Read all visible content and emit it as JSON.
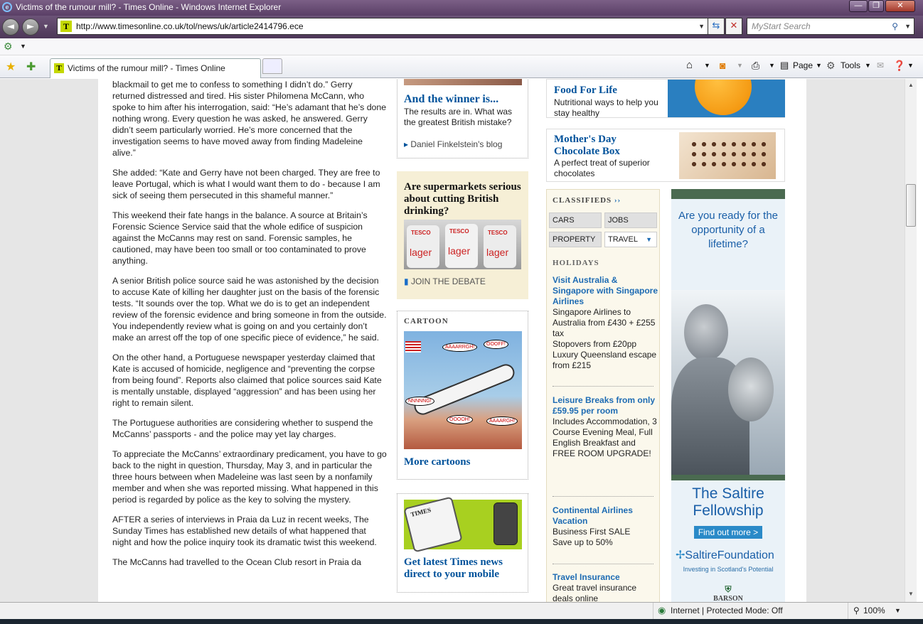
{
  "window": {
    "title": "Victims of the rumour mill? - Times Online - Windows Internet Explorer",
    "minimize": "—",
    "restore": "❐",
    "close": "✕"
  },
  "toolbar": {
    "url": "http://www.timesonline.co.uk/tol/news/uk/article2414796.ece",
    "search_placeholder": "MyStart Search",
    "favicon_letter": "T"
  },
  "tab": {
    "label": "Victims of the rumour mill? - Times Online"
  },
  "commandbar": {
    "page": "Page",
    "tools": "Tools"
  },
  "article": {
    "paragraphs": [
      "blackmail to get me to confess to something I didn’t do.” Gerry returned distressed and tired. His sister Philomena McCann, who spoke to him after his interrogation, said: “He’s adamant that he’s done nothing wrong. Every question he was asked, he answered. Gerry didn’t seem particularly worried. He’s more concerned that the investigation seems to have moved away from finding Madeleine alive.”",
      "She added: “Kate and Gerry have not been charged. They are free to leave Portugal, which is what I would want them to do - because I am sick of seeing them persecuted in this shameful manner.”",
      "This weekend their fate hangs in the balance. A source at Britain’s Forensic Science Service said that the whole edifice of suspicion against the McCanns may rest on sand. Forensic samples, he cautioned, may have been too small or too contaminated to prove anything.",
      "A senior British police source said he was astonished by the decision to accuse Kate of killing her daughter just on the basis of the forensic tests. “It sounds over the top. What we do is to get an independent review of the forensic evidence and bring someone in from the outside. You independently review what is going on and you certainly don’t make an arrest off the top of one specific piece of evidence,” he said.",
      "On the other hand, a Portuguese newspaper yesterday claimed that Kate is accused of homicide, negligence and “preventing the corpse from being found”. Reports also claimed that police sources said Kate is mentally unstable, displayed “aggression” and has been using her right to remain silent.",
      "The Portuguese authorities are considering whether to suspend the McCanns’ passports - and the police may yet lay charges.",
      "To appreciate the McCanns’ extraordinary predicament, you have to go back to the night in question, Thursday, May 3, and in particular the three hours between when Madeleine was last seen by a nonfamily member and when she was reported missing. What happened in this period is regarded by police as the key to solving the mystery.",
      "AFTER a series of interviews in Praia da Luz in recent weeks, The Sunday Times has established new details of what happened that night and how the police inquiry took its dramatic twist this weekend.",
      "The McCanns had travelled to the Ocean Club resort in Praia da"
    ]
  },
  "blog_box": {
    "title": "And the winner is...",
    "desc": "The results are in. What was the greatest British mistake?",
    "link": "Daniel Finkelstein's blog"
  },
  "debate_box": {
    "title": "Are supermarkets serious about cutting British drinking?",
    "link": "JOIN THE DEBATE",
    "can_text": "lager",
    "can_brand": "TESCO"
  },
  "cartoon_box": {
    "label": "CARTOON",
    "link": "More cartoons",
    "bubbles": [
      "AAAARRGH!",
      "OOOFF!",
      "NNNNNG!",
      "OOOOH!",
      "AAAARGH!"
    ]
  },
  "mobile_box": {
    "title": "Get latest Times news direct to your mobile",
    "brand": "TIMES"
  },
  "promos": [
    {
      "title": "Food For Life",
      "desc": "Nutritional ways to help you stay healthy"
    },
    {
      "title": "Mother's Day Chocolate Box",
      "desc": "A perfect treat of superior chocolates"
    }
  ],
  "classifieds": {
    "heading": "CLASSIFIEDS",
    "arrows": "››",
    "buttons": [
      "CARS",
      "JOBS",
      "PROPERTY",
      "TRAVEL"
    ],
    "section": "HOLIDAYS",
    "items": [
      {
        "title": "Visit Australia & Singapore with Singapore Airlines",
        "desc": "Singapore Airlines to Australia from £430 + £255 tax\nStopovers from £20pp\nLuxury Queensland escape from £215"
      },
      {
        "title": "Leisure Breaks from only £59.95 per room",
        "desc": "Includes Accommodation, 3 Course Evening Meal, Full English Breakfast and FREE ROOM UPGRADE!"
      },
      {
        "title": "Continental Airlines Vacation",
        "desc": "Business First SALE\nSave up to 50%"
      },
      {
        "title": "Travel Insurance",
        "desc": "Great travel insurance deals online"
      }
    ]
  },
  "ad": {
    "headline": "Are you ready for the opportunity of a lifetime?",
    "title": "The Saltire Fellowship",
    "button": "Find out more >",
    "foundation": "SaltireFoundation",
    "tagline": "Investing in Scotland's Potential",
    "sponsor": "BARSON"
  },
  "status": {
    "zone": "Internet | Protected Mode: Off",
    "zoom": "100%"
  },
  "colors": {
    "titlebar": "#5a3f66",
    "link_blue": "#00529b",
    "debate_bg": "#f6efd6",
    "classifieds_bg": "#fbf8ec",
    "ad_blue": "#1a5fa8"
  }
}
